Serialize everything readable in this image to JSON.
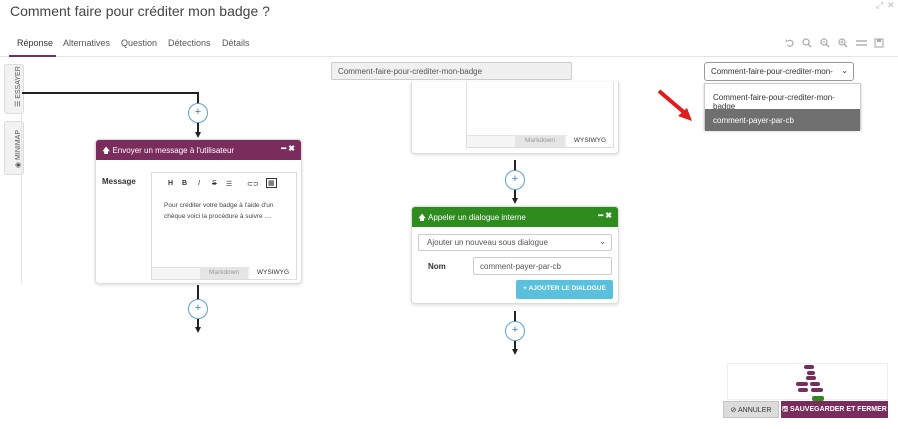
{
  "window": {
    "title": "Comment faire pour créditer mon badge ?",
    "controls": [
      "⤢",
      "✕"
    ]
  },
  "tabs": [
    {
      "label": "Réponse",
      "active": true
    },
    {
      "label": "Alternatives"
    },
    {
      "label": "Question"
    },
    {
      "label": "Détections"
    },
    {
      "label": "Détails"
    }
  ],
  "toolbar_icons": [
    "undo-icon",
    "zoom-icon",
    "zoom-out-icon",
    "zoom-in-icon",
    "align-icon",
    "save-icon"
  ],
  "side_tabs": {
    "essayer": "☰ ESSAYER",
    "minimap": "◉ MINIMAP"
  },
  "flow_name": "Comment-faire-pour-crediter-mon-badge",
  "flow_select": {
    "value": "Comment-faire-pour-crediter-mon-",
    "options": [
      "Comment-faire-pour-crediter-mon-badge",
      "comment-payer-par-cb"
    ]
  },
  "plus_glyph": "+",
  "send_card": {
    "header": "Envoyer un message à l'utilisateur",
    "message_label": "Message",
    "editor_tools": [
      "H",
      "B",
      "I",
      "S",
      "☰",
      "⊂⊃",
      "▦"
    ],
    "body_line1": "Pour créditer votre badge à l'aide d'un",
    "body_line2": "chèque voici la procédure à suivre ....",
    "markdown_tab": "Markdown",
    "wysiwyg_tab": "WYSIWYG"
  },
  "upper_card": {
    "markdown_tab": "Markdown",
    "wysiwyg_tab": "WYSIWYG"
  },
  "dialog_card": {
    "header": "Appeler un dialogue interne",
    "select_value": "Ajouter un nouveau sous dialogue",
    "nom_label": "Nom",
    "nom_value": "comment-payer-par-cb",
    "add_button": "+ AJOUTER LE DIALOGUE"
  },
  "footer": {
    "annuler": "⊘ ANNULER",
    "save": "🖫 SAUVEGARDER ET FERMER"
  },
  "colors": {
    "send_header": "#7a2d5c",
    "dialog_header": "#2e8b1e",
    "add_button": "#5bc0de",
    "selected_option": "#6f6f6f",
    "annotation_arrow": "#e31b1b"
  }
}
